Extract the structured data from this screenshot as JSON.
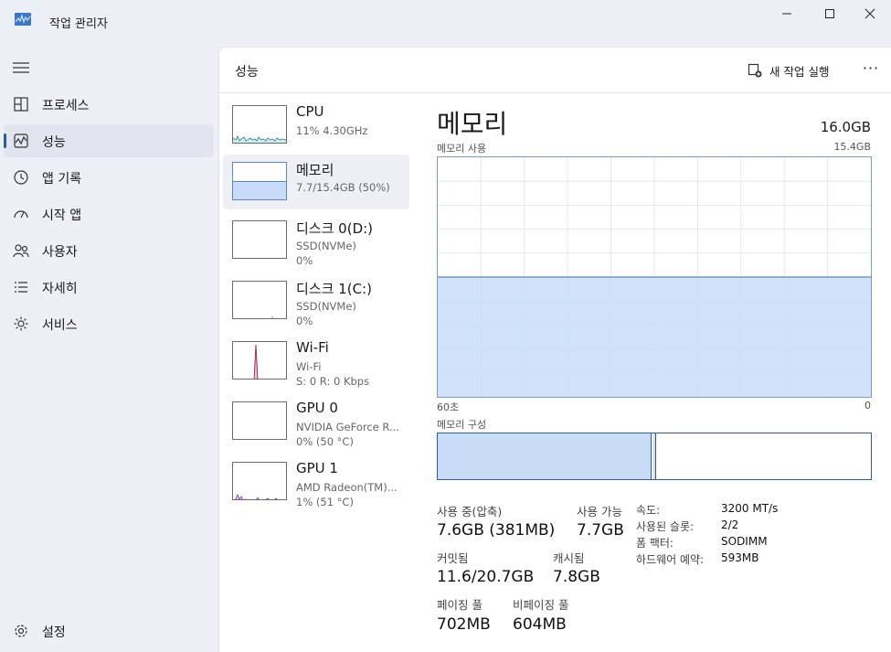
{
  "window": {
    "title": "작업 관리자"
  },
  "nav": {
    "items": [
      {
        "label": "프로세스",
        "icon": "processes-icon"
      },
      {
        "label": "성능",
        "icon": "performance-icon"
      },
      {
        "label": "앱 기록",
        "icon": "app-history-icon"
      },
      {
        "label": "시작 앱",
        "icon": "startup-apps-icon"
      },
      {
        "label": "사용자",
        "icon": "users-icon"
      },
      {
        "label": "자세히",
        "icon": "details-icon"
      },
      {
        "label": "서비스",
        "icon": "services-icon"
      }
    ],
    "settings_label": "설정"
  },
  "header": {
    "title": "성능",
    "run_task_label": "새 작업 실행",
    "more_label": "···"
  },
  "devices": [
    {
      "name": "CPU",
      "sub1": "11% 4.30GHz"
    },
    {
      "name": "메모리",
      "sub1": "7.7/15.4GB (50%)"
    },
    {
      "name": "디스크 0(D:)",
      "sub1": "SSD(NVMe)",
      "sub2": "0%"
    },
    {
      "name": "디스크 1(C:)",
      "sub1": "SSD(NVMe)",
      "sub2": "0%"
    },
    {
      "name": "Wi-Fi",
      "sub1": "Wi-Fi",
      "sub2": "S: 0 R: 0 Kbps"
    },
    {
      "name": "GPU 0",
      "sub1": "NVIDIA GeForce R...",
      "sub2": "0% (50 °C)"
    },
    {
      "name": "GPU 1",
      "sub1": "AMD Radeon(TM)...",
      "sub2": "1% (51 °C)"
    }
  ],
  "detail": {
    "title": "메모리",
    "total": "16.0GB",
    "usage_label": "메모리 사용",
    "usage_max": "15.4GB",
    "time_left": "60초",
    "time_right": "0",
    "composition_label": "메모리 구성",
    "usage_fraction": 0.5,
    "stats": {
      "in_use_label": "사용 중(압축)",
      "in_use": "7.6GB (381MB)",
      "available_label": "사용 가능",
      "available": "7.7GB",
      "committed_label": "커밋됨",
      "committed": "11.6/20.7GB",
      "cached_label": "캐시됨",
      "cached": "7.8GB",
      "paged_label": "페이징 풀",
      "paged": "702MB",
      "nonpaged_label": "비페이징 풀",
      "nonpaged": "604MB"
    },
    "specs": [
      {
        "k": "속도:",
        "v": "3200 MT/s"
      },
      {
        "k": "사용된 슬롯:",
        "v": "2/2"
      },
      {
        "k": "폼 팩터:",
        "v": "SODIMM"
      },
      {
        "k": "하드웨어 예약:",
        "v": "593MB"
      }
    ]
  },
  "colors": {
    "accent": "#2a5ea8",
    "memory_fill": "#c9ddf8",
    "graph_line": "#5b87c2",
    "grid": "#e3e8ef"
  }
}
